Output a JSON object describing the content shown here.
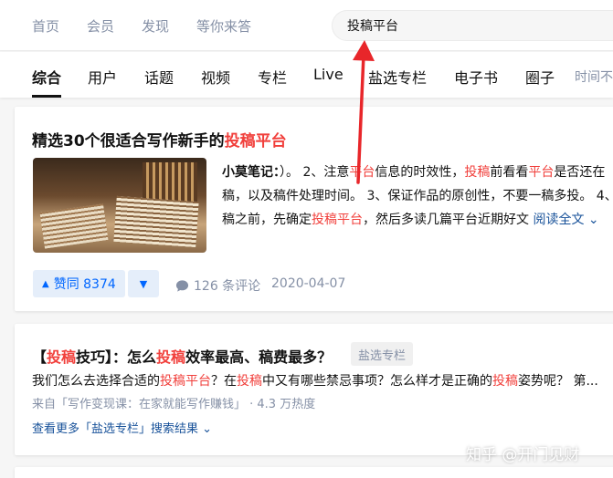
{
  "topnav": {
    "links": [
      "首页",
      "会员",
      "发现",
      "等你来答"
    ]
  },
  "search": {
    "value": "投稿平台"
  },
  "tabs": [
    "综合",
    "用户",
    "话题",
    "视频",
    "专栏",
    "Live",
    "盐选专栏",
    "电子书",
    "圈子",
    "时间不限"
  ],
  "result1": {
    "title_pre": "精选30个很适合写作新手的",
    "title_hl": "投稿平台",
    "excerpt_label": "小莫笔记：",
    "excerpt_a": "）。 2、注意",
    "excerpt_hl1": "平台",
    "excerpt_b": "信息的时效性，",
    "excerpt_hl2": "投稿",
    "excerpt_c": "前看看",
    "excerpt_hl3": "平台",
    "excerpt_d": "是否还在稿，以及稿件处理时间。 3、保证作品的原创性，不要一稿多投。 4、稿之前，先确定",
    "excerpt_hl4": "投稿平台",
    "excerpt_e": "，然后多读几篇平台近期好文",
    "read_all": "阅读全文",
    "vote_label": "赞同 8374",
    "comments": "126 条评论",
    "date": "2020-04-07"
  },
  "result2": {
    "title_a": "【",
    "title_hl1": "投稿",
    "title_b": "技巧】：怎么",
    "title_hl2": "投稿",
    "title_c": "效率最高、稿费最多？",
    "badge": "盐选专栏",
    "desc_a": "我们怎么去选择合适的",
    "desc_hl1": "投稿平台",
    "desc_b": "？在",
    "desc_hl2": "投稿",
    "desc_c": "中又有哪些禁忌事项？怎么样才是正确的",
    "desc_hl3": "投稿",
    "desc_d": "姿势呢？ 第...",
    "source": "来自「写作变现课：在家就能写作赚钱」 · 4.3 万热度",
    "more": "查看更多「盐选专栏」搜索结果"
  },
  "watermark": "知乎 @开门见财",
  "colors": {
    "highlight": "#f1403c",
    "primary": "#0066ff",
    "arrow": "#e8262a"
  }
}
